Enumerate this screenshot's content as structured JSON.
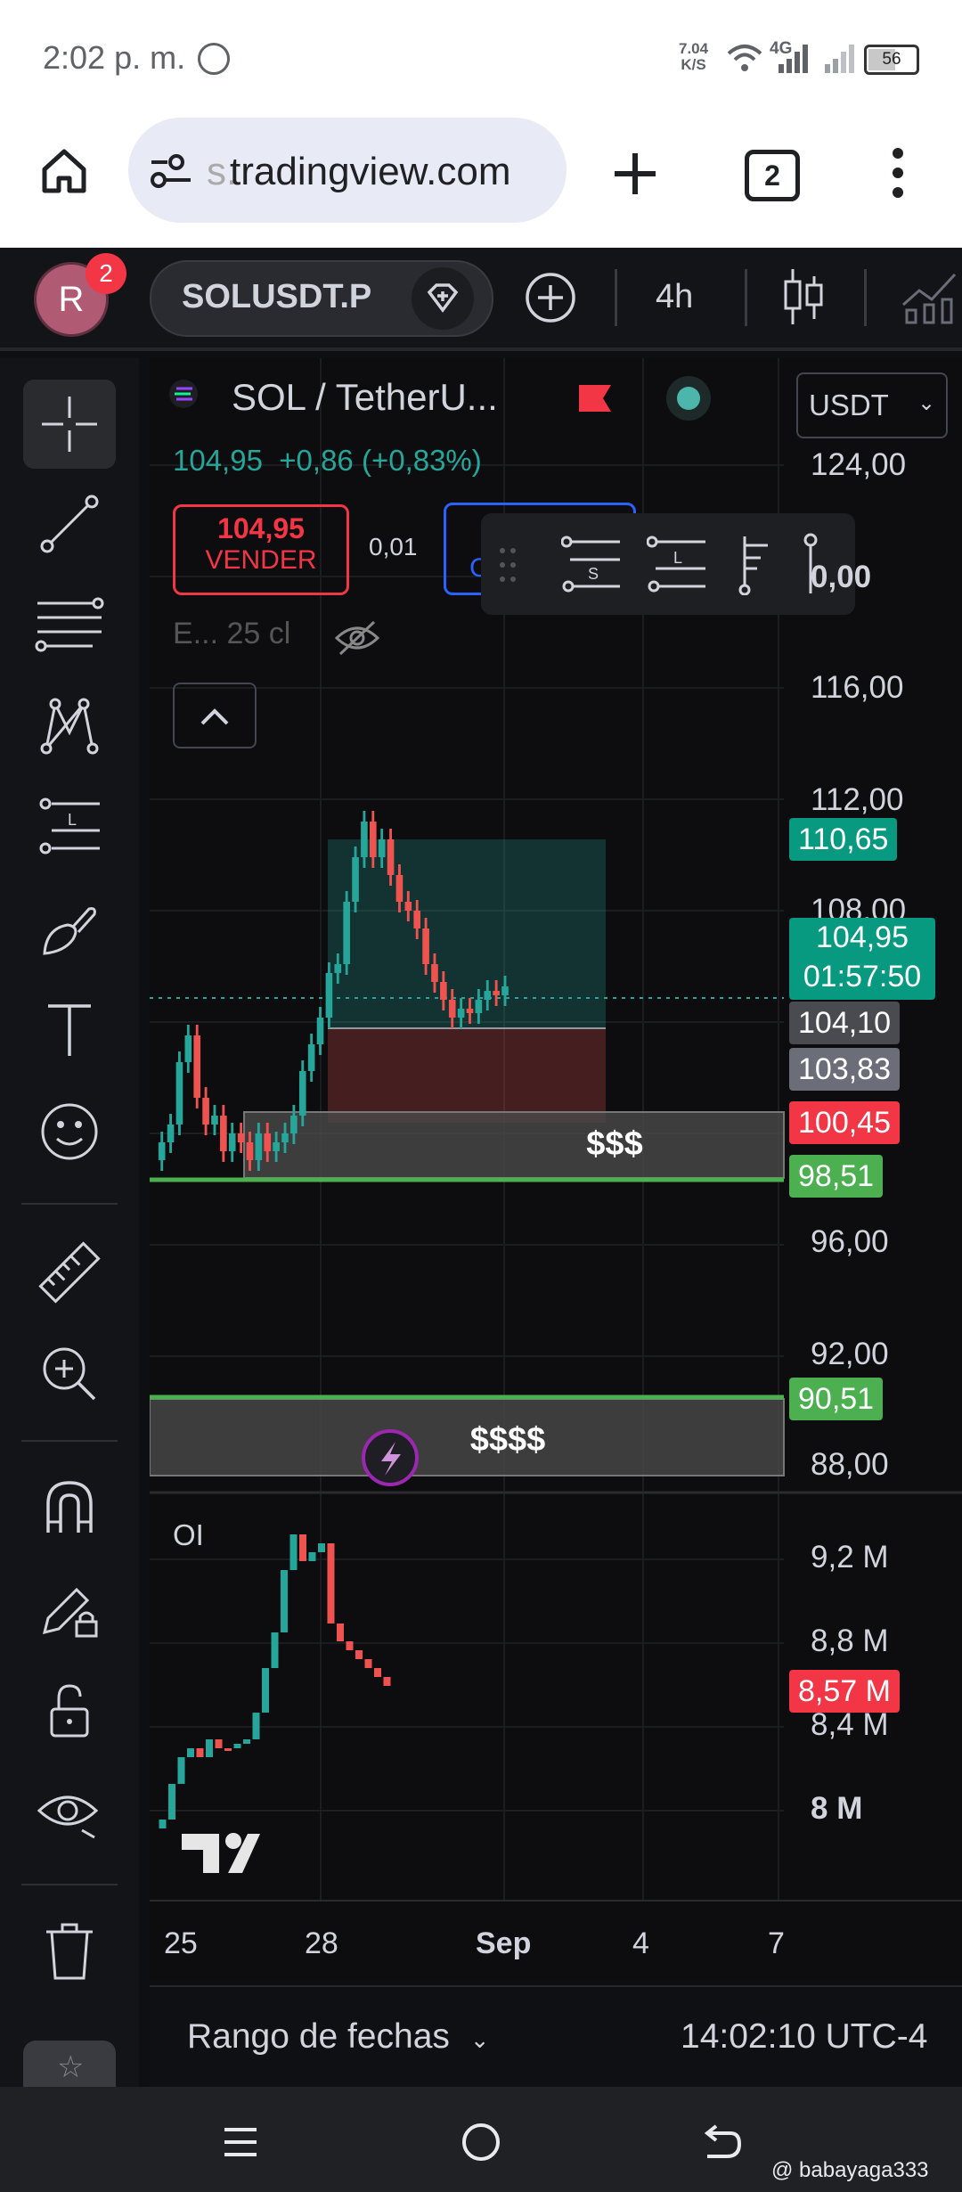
{
  "status": {
    "time": "2:02 p. m.",
    "net_speed_top": "7.04",
    "net_speed_bottom": "K/S",
    "network": "4G",
    "battery": "56"
  },
  "browser": {
    "url": "tradingview.com",
    "url_prefix": "s.",
    "tab_count": "2"
  },
  "toolbar": {
    "avatar_letter": "R",
    "notif_count": "2",
    "symbol": "SOLUSDT.P",
    "interval": "4h"
  },
  "legend": {
    "title": "SOL / TetherU...",
    "last_price": "104,95",
    "change": "+0,86 (+0,83%)",
    "sell_price": "104,95",
    "sell_label": "VENDER",
    "spread": "0,01",
    "buy_partial": "C",
    "indicator_label": "E... 25 cl",
    "currency": "USDT"
  },
  "price_axis": [
    "124,00",
    "0,00",
    "116,00",
    "112,00",
    "108,00",
    "96,00",
    "92,00",
    "88,00"
  ],
  "price_tags": {
    "tp": "110,65",
    "last": "104,95",
    "countdown": "01:57:50",
    "p1": "104,10",
    "p2": "103,83",
    "sl": "100,45",
    "green1": "98,51",
    "green2": "90,51"
  },
  "zones": {
    "zone1": "$$$",
    "zone2": "$$$$"
  },
  "oi_pane": {
    "label": "OI",
    "axis": [
      "9,2 M",
      "8,8 M",
      "8,4 M",
      "8 M"
    ],
    "last_tag": "8,57 M"
  },
  "time_axis": [
    "25",
    "28",
    "Sep",
    "4",
    "7"
  ],
  "bottom": {
    "range_label": "Rango de fechas",
    "clock": "14:02:10 UTC-4"
  },
  "watermark": "@ babayaga333",
  "colors": {
    "up": "#26a69a",
    "down": "#ef5350",
    "green_line": "#4caf50",
    "accent_blue": "#2962ff"
  }
}
